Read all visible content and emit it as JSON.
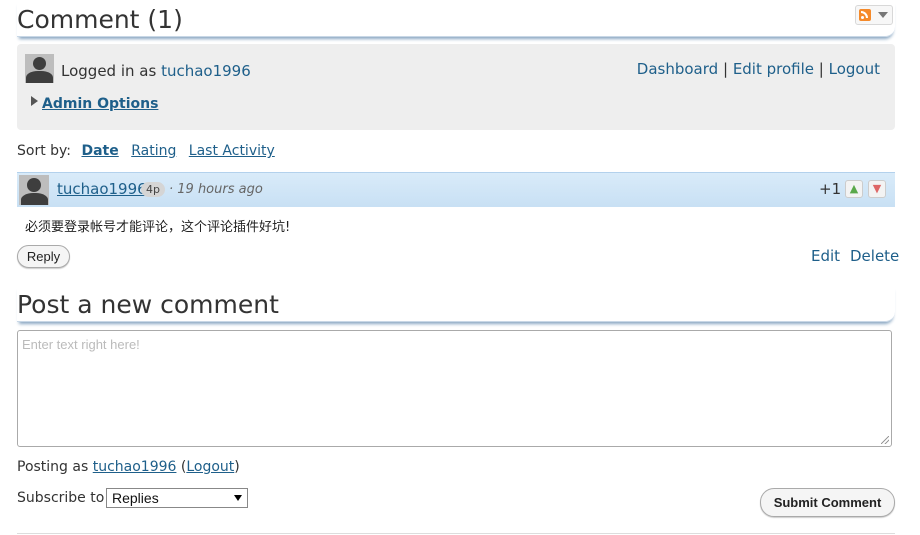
{
  "comments_section": {
    "title": "Comment (1)",
    "rss_icon": "rss-feed-icon"
  },
  "login_box": {
    "logged_in_prefix": "Logged in as",
    "username": "tuchao1996",
    "links": {
      "dashboard": "Dashboard",
      "edit_profile": "Edit profile",
      "logout": "Logout",
      "separator": "|"
    },
    "admin_options": "Admin Options"
  },
  "sort": {
    "label": "Sort by:",
    "options": [
      "Date",
      "Rating",
      "Last Activity"
    ],
    "active": "Date"
  },
  "comment": {
    "author": "tuchao1996",
    "points": "4p",
    "time": "· 19 hours ago",
    "score": "+1",
    "text": "必须要登录帐号才能评论，这个评论插件好坑!",
    "reply_label": "Reply",
    "edit_label": "Edit",
    "delete_label": "Delete"
  },
  "post_form": {
    "title": "Post a new comment",
    "placeholder": "Enter text right here!",
    "posting_as_prefix": "Posting as",
    "username": "tuchao1996",
    "logout_label": "Logout",
    "subscribe_label": "Subscribe to",
    "subscribe_value": "Replies",
    "submit_label": "Submit Comment"
  },
  "colors": {
    "link": "#1e5f8a",
    "comment_header_bg": "#d9ebf9",
    "login_box_bg": "#eeeeee"
  }
}
